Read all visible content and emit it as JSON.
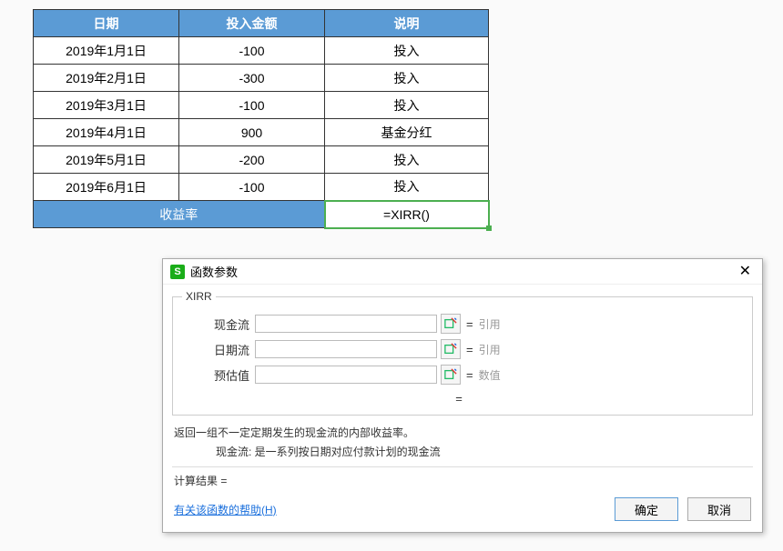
{
  "table": {
    "headers": {
      "date": "日期",
      "amount": "投入金额",
      "desc": "说明"
    },
    "rows": [
      {
        "date": "2019年1月1日",
        "amount": "-100",
        "desc": "投入"
      },
      {
        "date": "2019年2月1日",
        "amount": "-300",
        "desc": "投入"
      },
      {
        "date": "2019年3月1日",
        "amount": "-100",
        "desc": "投入"
      },
      {
        "date": "2019年4月1日",
        "amount": "900",
        "desc": "基金分红"
      },
      {
        "date": "2019年5月1日",
        "amount": "-200",
        "desc": "投入"
      },
      {
        "date": "2019年6月1日",
        "amount": "-100",
        "desc": "投入"
      }
    ],
    "return_label": "收益率",
    "formula": "=XIRR()"
  },
  "dialog": {
    "title": "函数参数",
    "func_name": "XIRR",
    "params": [
      {
        "label": "现金流",
        "hint": "引用"
      },
      {
        "label": "日期流",
        "hint": "引用"
      },
      {
        "label": "预估值",
        "hint": "数值"
      }
    ],
    "eq": "=",
    "desc1": "返回一组不一定定期发生的现金流的内部收益率。",
    "desc2": "现金流:   是一系列按日期对应付款计划的现金流",
    "result": "计算结果  =",
    "help": "有关该函数的帮助(H)",
    "ok": "确定",
    "cancel": "取消"
  }
}
